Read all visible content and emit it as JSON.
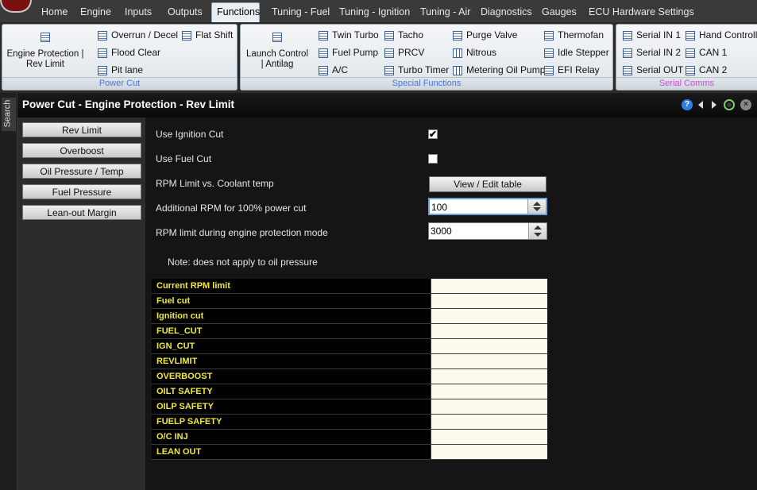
{
  "menu": {
    "tabs": [
      "Home",
      "Engine",
      "Inputs",
      "Outputs",
      "Functions",
      "Tuning - Fuel",
      "Tuning - Ignition",
      "Tuning - Air",
      "Diagnostics",
      "Gauges",
      "ECU Hardware Settings"
    ],
    "active": "Functions"
  },
  "ribbon": {
    "power_cut": {
      "label": "Power Cut",
      "big_button": "Engine Protection | Rev Limit",
      "items": [
        "Overrun / Decel",
        "Flat Shift",
        "Flood Clear",
        "Pit lane"
      ]
    },
    "special": {
      "label": "Special Functions",
      "big_button": "Launch Control | Antilag",
      "items": [
        "Twin Turbo",
        "Tacho",
        "Purge Valve",
        "Thermofan",
        "Fuel Pump",
        "PRCV",
        "Nitrous",
        "Idle Stepper",
        "A/C",
        "Turbo Timer",
        "Metering Oil Pump",
        "EFI Relay"
      ]
    },
    "serial": {
      "label": "Serial Comms",
      "items": [
        "Serial IN 1",
        "Hand Controller",
        "Serial IN 2",
        "CAN 1",
        "Serial OUT",
        "CAN 2"
      ]
    }
  },
  "search_tab": "Search",
  "panel": {
    "title": "Power Cut - Engine Protection - Rev Limit",
    "help_label": "?",
    "close_label": "×",
    "nav": [
      "Rev Limit",
      "Overboost",
      "Oil Pressure / Temp",
      "Fuel Pressure",
      "Lean-out Margin"
    ],
    "form": {
      "use_ignition_cut": {
        "label": "Use Ignition Cut",
        "checked": true,
        "mark": "✔"
      },
      "use_fuel_cut": {
        "label": "Use Fuel Cut",
        "checked": false,
        "mark": ""
      },
      "rpm_vs_coolant": {
        "label": "RPM Limit vs. Coolant temp",
        "button": "View / Edit table"
      },
      "additional_rpm": {
        "label": "Additional RPM for 100% power cut",
        "value": "100"
      },
      "protection_rpm": {
        "label": "RPM limit during engine protection mode",
        "value": "3000"
      },
      "note": "Note: does not apply to oil pressure"
    },
    "status_rows": [
      "Current RPM limit",
      "Fuel cut",
      "Ignition cut",
      "FUEL_CUT",
      "IGN_CUT",
      "REVLIMIT",
      "OVERBOOST",
      "OILT SAFETY",
      "OILP SAFETY",
      "FUELP SAFETY",
      "O/C INJ",
      "LEAN OUT"
    ]
  }
}
